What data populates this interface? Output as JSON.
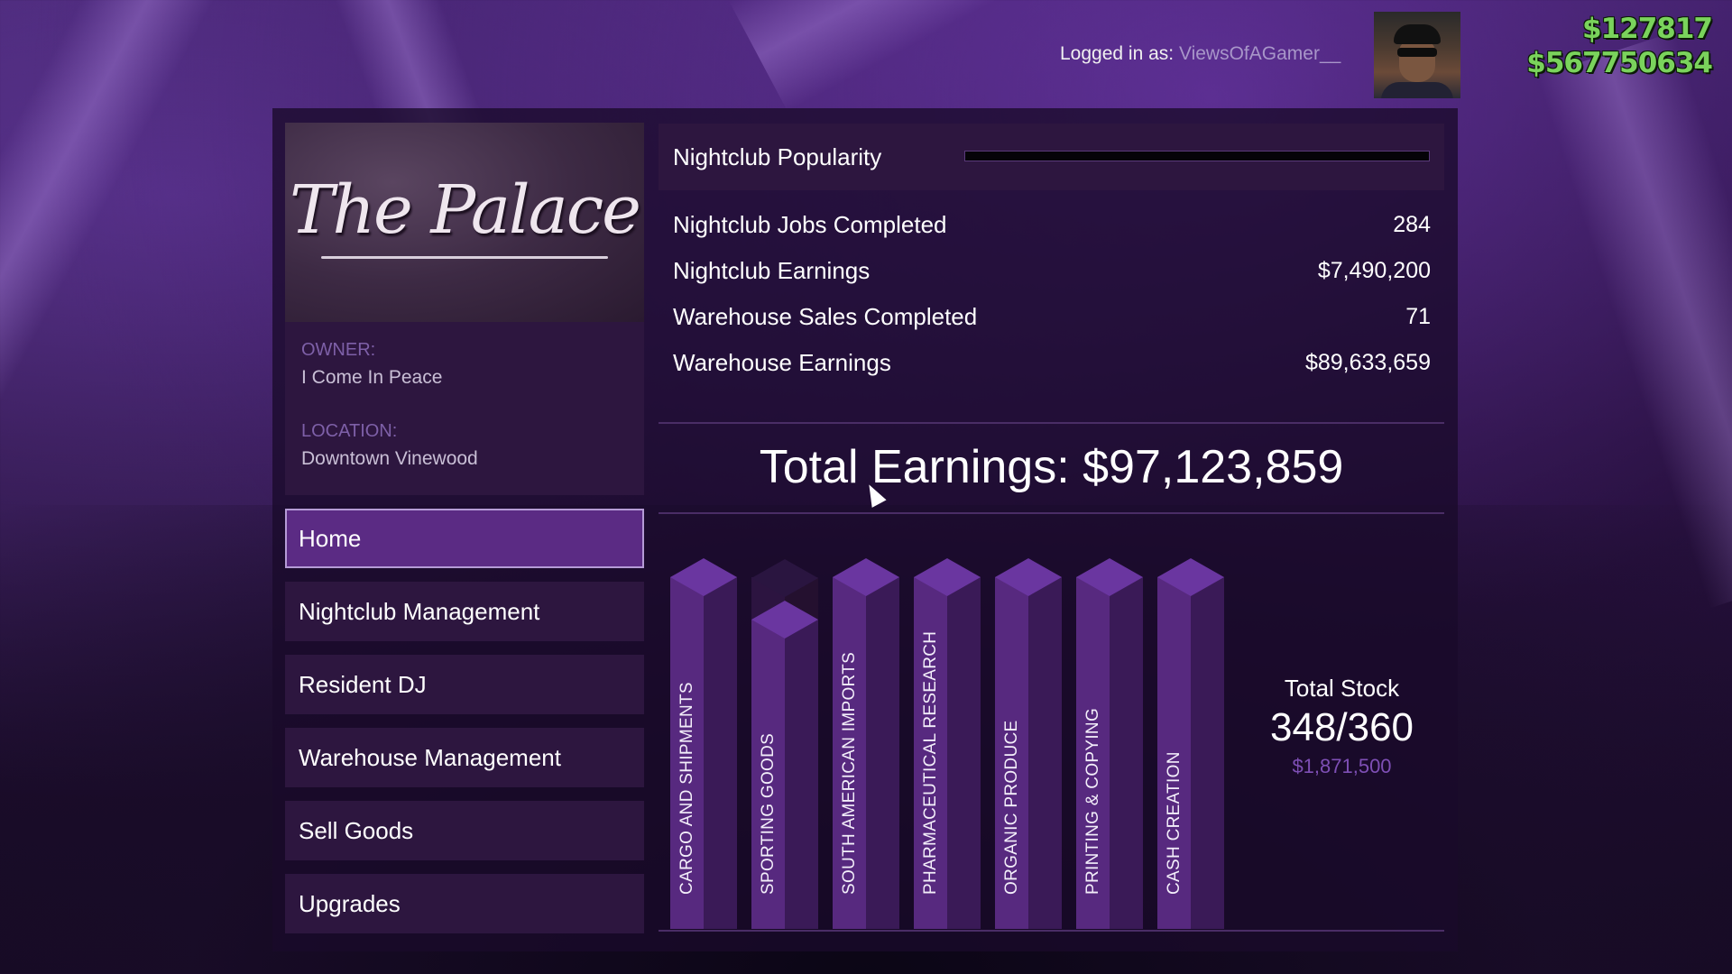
{
  "header": {
    "logged_in_label": "Logged in as:",
    "username": "ViewsOfAGamer__",
    "cash": "$127817",
    "bank": "$567750634"
  },
  "business": {
    "logo_text": "The Palace",
    "owner_label": "OWNER:",
    "owner_value": "I Come In Peace",
    "location_label": "LOCATION:",
    "location_value": "Downtown Vinewood"
  },
  "nav": {
    "items": [
      {
        "label": "Home",
        "active": true
      },
      {
        "label": "Nightclub Management",
        "active": false
      },
      {
        "label": "Resident DJ",
        "active": false
      },
      {
        "label": "Warehouse Management",
        "active": false
      },
      {
        "label": "Sell Goods",
        "active": false
      },
      {
        "label": "Upgrades",
        "active": false
      }
    ]
  },
  "stats": {
    "popularity_label": "Nightclub Popularity",
    "popularity_fraction": 0.0,
    "rows": [
      {
        "label": "Nightclub Jobs Completed",
        "value": "284"
      },
      {
        "label": "Nightclub Earnings",
        "value": "$7,490,200"
      },
      {
        "label": "Warehouse Sales Completed",
        "value": "71"
      },
      {
        "label": "Warehouse Earnings",
        "value": "$89,633,659"
      }
    ],
    "total_earnings": "Total Earnings: $97,123,859"
  },
  "stock": {
    "title": "Total Stock",
    "value": "348/360",
    "money": "$1,871,500"
  },
  "chart_data": {
    "type": "bar",
    "categories": [
      "CARGO AND SHIPMENTS",
      "SPORTING GOODS",
      "SOUTH AMERICAN IMPORTS",
      "PHARMACEUTICAL RESEARCH",
      "ORGANIC PRODUCE",
      "PRINTING & COPYING",
      "CASH CREATION"
    ],
    "fill_fraction": [
      1.0,
      0.88,
      1.0,
      1.0,
      1.0,
      1.0,
      1.0
    ]
  },
  "colors": {
    "accent": "#57297f",
    "accent_side": "#3a1a57",
    "money_green": "#7ad35c",
    "panel": "#2d163f"
  }
}
